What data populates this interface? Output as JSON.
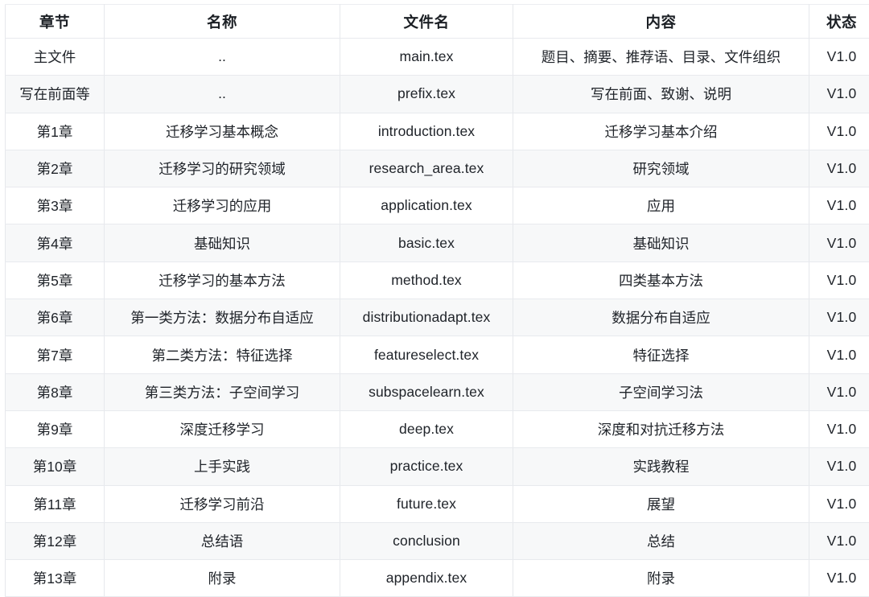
{
  "table": {
    "columns": [
      {
        "key": "chapter",
        "label": "章节"
      },
      {
        "key": "name",
        "label": "名称"
      },
      {
        "key": "file",
        "label": "文件名"
      },
      {
        "key": "content",
        "label": "内容"
      },
      {
        "key": "status",
        "label": "状态"
      }
    ],
    "rows": [
      {
        "chapter": "主文件",
        "name": "..",
        "file": "main.tex",
        "content": "题目、摘要、推荐语、目录、文件组织",
        "status": "V1.0"
      },
      {
        "chapter": "写在前面等",
        "name": "..",
        "file": "prefix.tex",
        "content": "写在前面、致谢、说明",
        "status": "V1.0"
      },
      {
        "chapter": "第1章",
        "name": "迁移学习基本概念",
        "file": "introduction.tex",
        "content": "迁移学习基本介绍",
        "status": "V1.0"
      },
      {
        "chapter": "第2章",
        "name": "迁移学习的研究领域",
        "file": "research_area.tex",
        "content": "研究领域",
        "status": "V1.0"
      },
      {
        "chapter": "第3章",
        "name": "迁移学习的应用",
        "file": "application.tex",
        "content": "应用",
        "status": "V1.0"
      },
      {
        "chapter": "第4章",
        "name": "基础知识",
        "file": "basic.tex",
        "content": "基础知识",
        "status": "V1.0"
      },
      {
        "chapter": "第5章",
        "name": "迁移学习的基本方法",
        "file": "method.tex",
        "content": "四类基本方法",
        "status": "V1.0"
      },
      {
        "chapter": "第6章",
        "name": "第一类方法：数据分布自适应",
        "file": "distributionadapt.tex",
        "content": "数据分布自适应",
        "status": "V1.0"
      },
      {
        "chapter": "第7章",
        "name": "第二类方法：特征选择",
        "file": "featureselect.tex",
        "content": "特征选择",
        "status": "V1.0"
      },
      {
        "chapter": "第8章",
        "name": "第三类方法：子空间学习",
        "file": "subspacelearn.tex",
        "content": "子空间学习法",
        "status": "V1.0"
      },
      {
        "chapter": "第9章",
        "name": "深度迁移学习",
        "file": "deep.tex",
        "content": "深度和对抗迁移方法",
        "status": "V1.0"
      },
      {
        "chapter": "第10章",
        "name": "上手实践",
        "file": "practice.tex",
        "content": "实践教程",
        "status": "V1.0"
      },
      {
        "chapter": "第11章",
        "name": "迁移学习前沿",
        "file": "future.tex",
        "content": "展望",
        "status": "V1.0"
      },
      {
        "chapter": "第12章",
        "name": "总结语",
        "file": "conclusion",
        "content": "总结",
        "status": "V1.0"
      },
      {
        "chapter": "第13章",
        "name": "附录",
        "file": "appendix.tex",
        "content": "附录",
        "status": "V1.0"
      }
    ]
  },
  "style": {
    "header_text_color": "#1b1f24",
    "body_text_color": "#20242a",
    "border_color": "#e6e8ec",
    "stripe_color": "#f7f8f9",
    "background_color": "#ffffff"
  }
}
